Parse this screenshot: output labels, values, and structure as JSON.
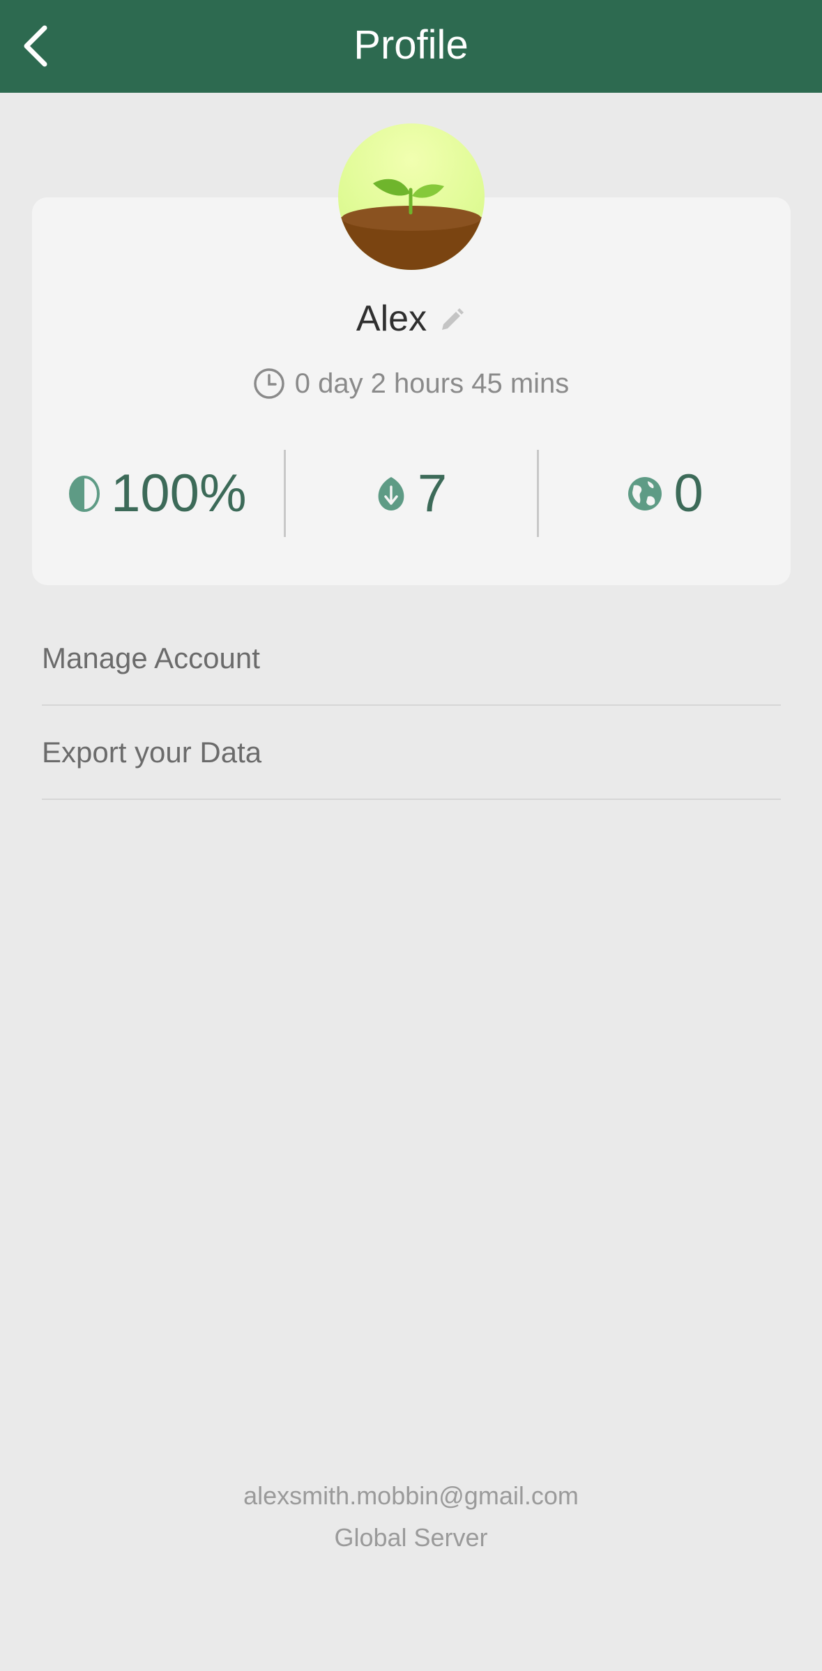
{
  "header": {
    "title": "Profile",
    "back_icon": "chevron-left-icon",
    "background": "#2d6a50"
  },
  "profile": {
    "avatar_icon": "sprout-icon",
    "name": "Alex",
    "edit_icon": "pencil-icon",
    "focus_time": "0 day 2 hours 45 mins",
    "time_icon": "clock-icon"
  },
  "stats": [
    {
      "icon": "half-circle-icon",
      "value": "100%"
    },
    {
      "icon": "leaf-icon",
      "value": "7"
    },
    {
      "icon": "globe-icon",
      "value": "0"
    }
  ],
  "menu": {
    "items": [
      {
        "label": "Manage Account"
      },
      {
        "label": "Export your Data"
      }
    ]
  },
  "footer": {
    "email": "alexsmith.mobbin@gmail.com",
    "server": "Global Server"
  },
  "colors": {
    "accent": "#3c6a58",
    "icon": "#5e9b85"
  }
}
